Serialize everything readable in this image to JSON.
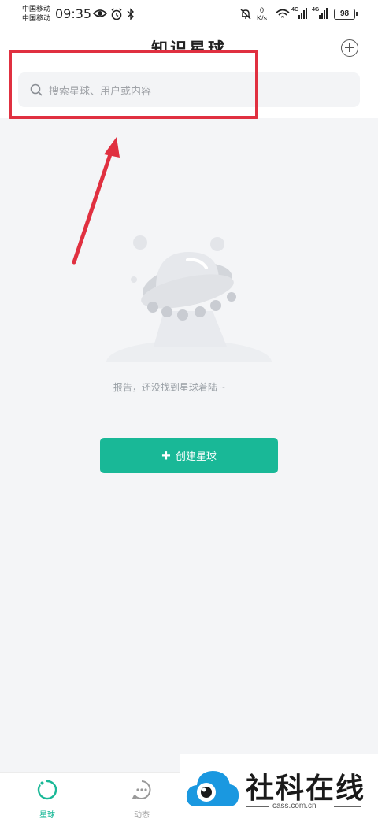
{
  "status_bar": {
    "carrier_1": "中国移动",
    "carrier_2": "中国移动",
    "time": "09:35",
    "net_speed_value": "0",
    "net_speed_unit": "K/s",
    "signal_1_label": "4G",
    "signal_2_label": "4G",
    "battery": "98"
  },
  "header": {
    "title": "知识星球",
    "search_placeholder": "搜索星球、用户或内容"
  },
  "empty_state": {
    "message": "报告，还没找到星球着陆 ~",
    "create_button_label": "创建星球"
  },
  "tab_bar": {
    "tabs": [
      {
        "label": "星球",
        "active": true
      },
      {
        "label": "动态",
        "active": false
      }
    ]
  },
  "watermark": {
    "brand": "社科在线",
    "url": "cass.com.cn"
  },
  "colors": {
    "accent": "#19b897",
    "highlight": "#e03040"
  }
}
